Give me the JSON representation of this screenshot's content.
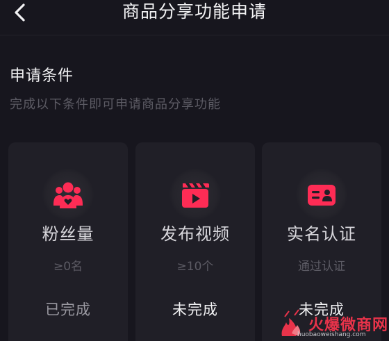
{
  "header": {
    "title": "商品分享功能申请",
    "back_icon": "chevron-left-icon"
  },
  "section": {
    "title": "申请条件",
    "subtitle": "完成以下条件即可申请商品分享功能"
  },
  "conditions": [
    {
      "icon": "fans-icon",
      "name": "粉丝量",
      "requirement": "≥0名",
      "status": "已完成",
      "completed": true
    },
    {
      "icon": "video-icon",
      "name": "发布视频",
      "requirement": "≥10个",
      "status": "未完成",
      "completed": false
    },
    {
      "icon": "id-card-icon",
      "name": "实名认证",
      "requirement": "通过认证",
      "status": "未完成",
      "completed": false
    }
  ],
  "watermark": {
    "text": "火爆微商网",
    "url": "huobaoweishang.com"
  },
  "colors": {
    "background": "#17161e",
    "card": "#201f27",
    "accent": "#fe2c55",
    "text_primary": "#f2f2f4",
    "text_secondary": "#5c5b64",
    "text_done": "#9a99a1",
    "watermark": "#e8334a"
  }
}
